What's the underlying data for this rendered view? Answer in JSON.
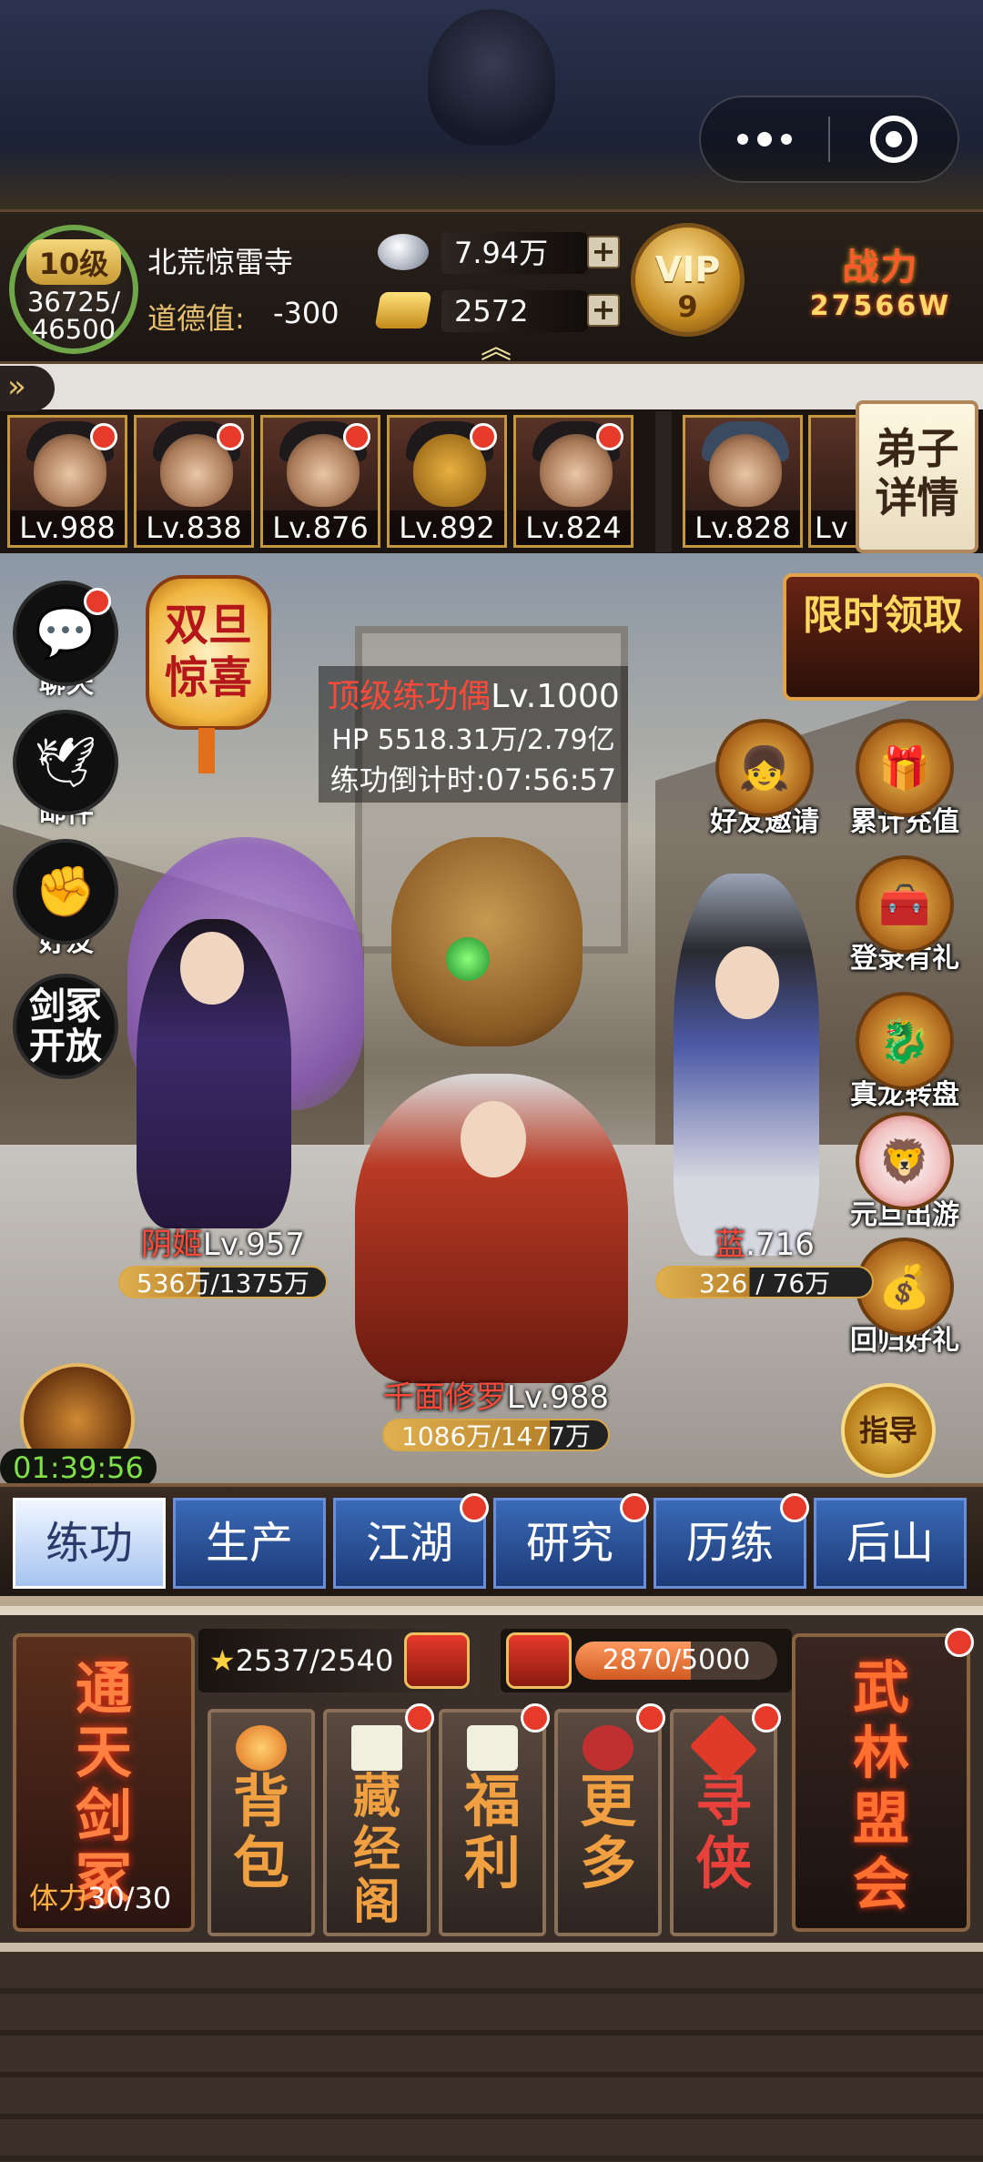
{
  "player": {
    "level": "10级",
    "xp": "36725/",
    "xp_max": "46500",
    "name": "北荒惊雷寺",
    "morality_label": "道德值:",
    "morality_value": "-300",
    "silver": "7.94万",
    "gold": "2572",
    "vip_label": "VIP",
    "vip_level": "9",
    "power_label": "战力",
    "power_value": "27566W"
  },
  "disciples": [
    {
      "lv": "Lv.988"
    },
    {
      "lv": "Lv.838"
    },
    {
      "lv": "Lv.876"
    },
    {
      "lv": "Lv.892"
    },
    {
      "lv": "Lv.824"
    },
    {
      "lv": "Lv.828"
    },
    {
      "lv": "Lv"
    }
  ],
  "detail_button": "弟子详情",
  "left_buttons": {
    "chat": "聊天",
    "mail": "邮件",
    "friends": "好友",
    "sword": "剑冢开放"
  },
  "lantern": "双旦惊喜",
  "boss": {
    "name": "顶级练功偶",
    "level": "Lv.1000",
    "hp": "HP 5518.31万/2.79亿",
    "countdown": "练功倒计时:07:56:57"
  },
  "limited": "限时领取",
  "right_buttons": {
    "invite": "好友邀请",
    "recharge": "累计充值",
    "login": "登录有礼",
    "dragon": "真龙转盘",
    "newyear": "元旦出游",
    "return": "回归好礼"
  },
  "heroes": {
    "left": {
      "name": "阴姬",
      "lv": "Lv.957",
      "hp": "536万/1375万",
      "fill": 0.39
    },
    "mid": {
      "name": "千面修罗",
      "lv": "Lv.988",
      "hp": "1086万/1477万",
      "fill": 0.74
    },
    "right": {
      "name": "蓝",
      "lv": ".716",
      "hp": "326  /  76万",
      "fill": 0.43
    }
  },
  "timer": "01:39:56",
  "guide": "指导",
  "tabs": [
    "练功",
    "生产",
    "江湖",
    "研究",
    "历练",
    "后山"
  ],
  "bottom": {
    "tongtian": "通天剑冢",
    "stamina_label": "体力",
    "stamina_value": "30/30",
    "stars": "2537/2540",
    "progress": "2870/5000",
    "progress_fill": 0.574,
    "features": [
      "背包",
      "藏经阁",
      "福利",
      "更多",
      "寻侠"
    ],
    "wulin": "武林盟会"
  },
  "colors": {
    "accent_red": "#e63a2a",
    "tab_blue": "#1d3a78",
    "gold": "#f0c050"
  }
}
